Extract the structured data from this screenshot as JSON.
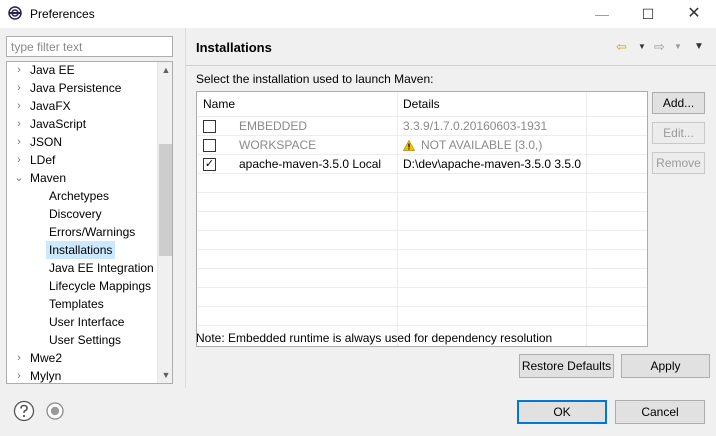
{
  "window": {
    "title": "Preferences",
    "min_glyph": "—",
    "max_glyph": "☐",
    "close_glyph": "✕"
  },
  "filter": {
    "placeholder": "type filter text",
    "value": ""
  },
  "tree": {
    "items": [
      {
        "label": "Java EE",
        "arrow": "›"
      },
      {
        "label": "Java Persistence",
        "arrow": "›"
      },
      {
        "label": "JavaFX",
        "arrow": "›"
      },
      {
        "label": "JavaScript",
        "arrow": "›"
      },
      {
        "label": "JSON",
        "arrow": "›"
      },
      {
        "label": "LDef",
        "arrow": "›"
      },
      {
        "label": "Maven",
        "arrow": "⌄"
      },
      {
        "label": "Archetypes"
      },
      {
        "label": "Discovery"
      },
      {
        "label": "Errors/Warnings"
      },
      {
        "label": "Installations"
      },
      {
        "label": "Java EE Integration"
      },
      {
        "label": "Lifecycle Mappings"
      },
      {
        "label": "Templates"
      },
      {
        "label": "User Interface"
      },
      {
        "label": "User Settings"
      },
      {
        "label": "Mwe2",
        "arrow": "›"
      },
      {
        "label": "Mylyn",
        "arrow": "›"
      }
    ],
    "selected": "Installations",
    "scroll_up": "▲",
    "scroll_down": "▼"
  },
  "page": {
    "title": "Installations",
    "instruction": "Select the installation used to launch Maven:",
    "note": "Note: Embedded runtime is always used for dependency resolution"
  },
  "nav": {
    "back_glyph": "⇦",
    "drop_glyph": "▼",
    "forward_glyph": "⇨",
    "menu_glyph": "▼"
  },
  "table": {
    "columns": [
      "Name",
      "Details"
    ],
    "rows": [
      {
        "checked": false,
        "check_glyph": "",
        "name": "EMBEDDED",
        "details": "3.3.9/1.7.0.20160603-1931",
        "disabled": true,
        "warning": false
      },
      {
        "checked": false,
        "check_glyph": "",
        "name": "WORKSPACE",
        "details": "NOT AVAILABLE [3.0,)",
        "disabled": true,
        "warning": true
      },
      {
        "checked": true,
        "check_glyph": "✓",
        "name": "apache-maven-3.5.0 Local",
        "details": "D:\\dev\\apache-maven-3.5.0 3.5.0",
        "disabled": false,
        "warning": false
      }
    ]
  },
  "side_buttons": {
    "add": "Add...",
    "edit": "Edit...",
    "remove": "Remove"
  },
  "buttons": {
    "restore_defaults": "Restore Defaults",
    "apply": "Apply",
    "ok": "OK",
    "cancel": "Cancel"
  },
  "colors": {
    "selection": "#cce8ff",
    "default_button_border": "#0078d7",
    "warning": "#f2c200"
  }
}
